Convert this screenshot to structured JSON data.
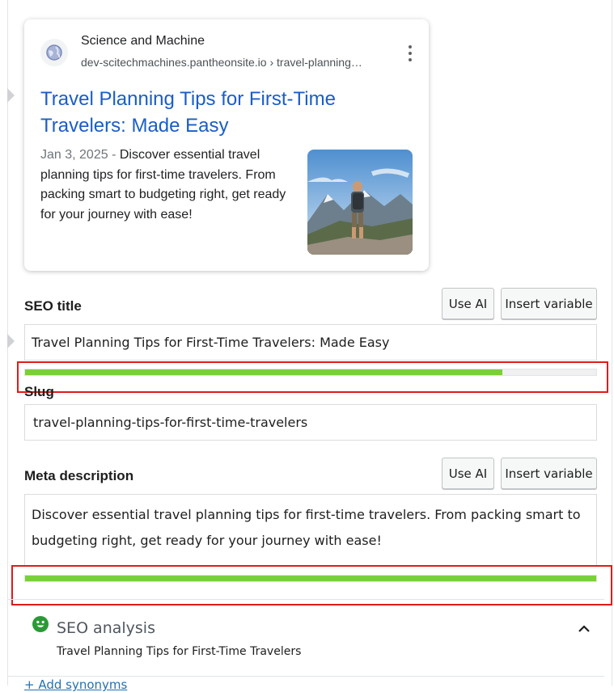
{
  "preview": {
    "site_name": "Science and Machine",
    "site_url": "dev-scitechmachines.pantheonsite.io › travel-planning…",
    "title": "Travel Planning Tips for First-Time Travelers: Made Easy",
    "date": "Jan 3, 2025",
    "separator": " - ",
    "snippet": "Discover essential travel planning tips for first-time travelers. From packing smart to budgeting right, get ready for your journey with ease!"
  },
  "seo_title": {
    "label": "SEO title",
    "use_ai": "Use AI",
    "insert_variable": "Insert variable",
    "value": "Travel Planning Tips for First-Time Travelers: Made Easy",
    "progress": 0.835
  },
  "slug": {
    "label": "Slug",
    "value": "travel-planning-tips-for-first-time-travelers"
  },
  "meta_description": {
    "label": "Meta description",
    "use_ai": "Use AI",
    "insert_variable": "Insert variable",
    "value": "Discover essential travel planning tips for first-time travelers. From packing smart to budgeting right, get ready for your journey with ease!",
    "progress": 1.0
  },
  "seo_analysis": {
    "title": "SEO analysis",
    "keyphrase": "Travel Planning Tips for First-Time Travelers",
    "status_icon": "smiley-green-icon"
  },
  "add_synonyms": "+ Add synonyms",
  "colors": {
    "accent_green": "#7ad03a",
    "highlight_red": "#e01b1b",
    "link_blue": "#1a5dc7"
  }
}
